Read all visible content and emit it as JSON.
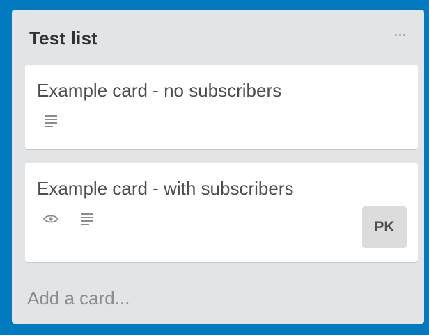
{
  "list": {
    "title": "Test list",
    "menu_icon": "ellipsis-icon",
    "cards": [
      {
        "title": "Example card - no subscribers",
        "badges": [
          "description-icon"
        ]
      },
      {
        "title": "Example card - with subscribers",
        "badges": [
          "eye-icon",
          "description-icon"
        ],
        "member_initials": "PK"
      }
    ],
    "add_card_label": "Add a card..."
  },
  "colors": {
    "board_background": "#0079bf",
    "list_background": "#e2e4e6",
    "card_background": "#ffffff"
  }
}
